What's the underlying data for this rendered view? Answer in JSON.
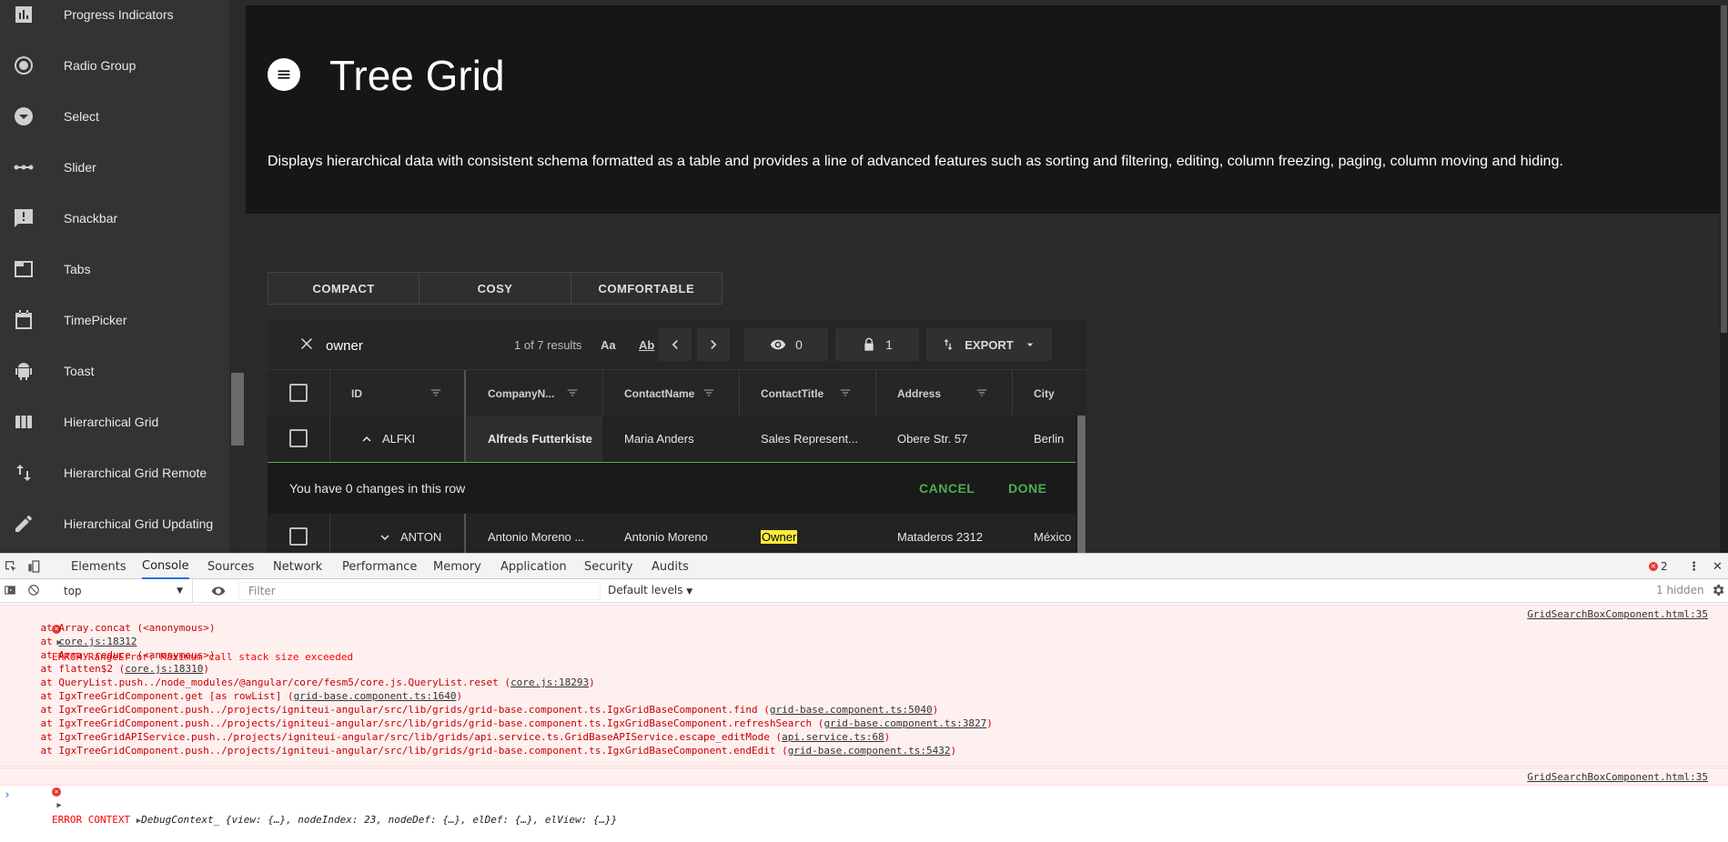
{
  "sidebar": {
    "items": [
      {
        "label": "Progress Indicators",
        "icon": "bar-chart-icon"
      },
      {
        "label": "Radio Group",
        "icon": "radio-button-icon"
      },
      {
        "label": "Select",
        "icon": "dropdown-circle-icon"
      },
      {
        "label": "Slider",
        "icon": "slider-dots-icon"
      },
      {
        "label": "Snackbar",
        "icon": "feedback-icon"
      },
      {
        "label": "Tabs",
        "icon": "tab-icon"
      },
      {
        "label": "TimePicker",
        "icon": "calendar-icon"
      },
      {
        "label": "Toast",
        "icon": "android-icon"
      },
      {
        "label": "Hierarchical Grid",
        "icon": "columns-icon"
      },
      {
        "label": "Hierarchical Grid Remote",
        "icon": "swap-vert-icon"
      },
      {
        "label": "Hierarchical Grid Updating",
        "icon": "edit-icon"
      }
    ]
  },
  "hero": {
    "title": "Tree Grid",
    "description": "Displays hierarchical data with consistent schema formatted as a table and provides a line of advanced features such as sorting and filtering, editing, column freezing, paging, column moving and hiding."
  },
  "density": {
    "buttons": [
      "COMPACT",
      "COSY",
      "COMFORTABLE"
    ]
  },
  "toolbar": {
    "search_value": "owner",
    "results": "1 of 7 results",
    "case_label": "Aa",
    "exact_label": "Ab",
    "hidden_count": "0",
    "pinned_count": "1",
    "export_label": "EXPORT"
  },
  "grid": {
    "columns": [
      "ID",
      "CompanyN...",
      "ContactName",
      "ContactTitle",
      "Address",
      "City"
    ],
    "rows": [
      {
        "id": "ALFKI",
        "company": "Alfreds Futterkiste",
        "contact": "Maria Anders",
        "title": "Sales Represent...",
        "address": "Obere Str. 57",
        "city": "Berlin"
      },
      {
        "id": "ANTON",
        "company": "Antonio Moreno ...",
        "contact": "Antonio Moreno",
        "title": "Owner",
        "address": "Mataderos 2312",
        "city": "México"
      }
    ],
    "edit_message": "You have 0 changes in this row",
    "cancel_label": "CANCEL",
    "done_label": "DONE"
  },
  "devtools": {
    "tabs": [
      "Elements",
      "Console",
      "Sources",
      "Network",
      "Performance",
      "Memory",
      "Application",
      "Security",
      "Audits"
    ],
    "active_tab": "Console",
    "error_count": "2",
    "context": "top",
    "filter_placeholder": "Filter",
    "levels": "Default levels",
    "hidden": "1 hidden",
    "error1": {
      "title": "ERROR RangeError: Maximum call stack size exceeded",
      "source": "GridSearchBoxComponent.html:35",
      "stack": [
        {
          "text": "    at Array.concat (<anonymous>)",
          "link": ""
        },
        {
          "text": "    at ",
          "link": "core.js:18312"
        },
        {
          "text": "    at Array.reduce (<anonymous>)",
          "link": ""
        },
        {
          "text": "    at flatten$2 (",
          "link": "core.js:18310",
          "tail": ")"
        },
        {
          "text": "    at QueryList.push../node_modules/@angular/core/fesm5/core.js.QueryList.reset (",
          "link": "core.js:18293",
          "tail": ")"
        },
        {
          "text": "    at IgxTreeGridComponent.get [as rowList] (",
          "link": "grid-base.component.ts:1640",
          "tail": ")"
        },
        {
          "text": "    at IgxTreeGridComponent.push../projects/igniteui-angular/src/lib/grids/grid-base.component.ts.IgxGridBaseComponent.find (",
          "link": "grid-base.component.ts:5040",
          "tail": ")"
        },
        {
          "text": "    at IgxTreeGridComponent.push../projects/igniteui-angular/src/lib/grids/grid-base.component.ts.IgxGridBaseComponent.refreshSearch (",
          "link": "grid-base.component.ts:3827",
          "tail": ")"
        },
        {
          "text": "    at IgxTreeGridAPIService.push../projects/igniteui-angular/src/lib/grids/api.service.ts.GridBaseAPIService.escape_editMode (",
          "link": "api.service.ts:68",
          "tail": ")"
        },
        {
          "text": "    at IgxTreeGridComponent.push../projects/igniteui-angular/src/lib/grids/grid-base.component.ts.IgxGridBaseComponent.endEdit (",
          "link": "grid-base.component.ts:5432",
          "tail": ")"
        }
      ]
    },
    "error2": {
      "prefix": "ERROR CONTEXT ",
      "object": "DebugContext_ {view: {…}, nodeIndex: 23, nodeDef: {…}, elDef: {…}, elView: {…}}",
      "source": "GridSearchBoxComponent.html:35"
    },
    "prompt": "›"
  },
  "colors": {
    "accent_green": "#4caf50",
    "highlight": "#ffeb3b",
    "error_red": "#ff0000"
  }
}
